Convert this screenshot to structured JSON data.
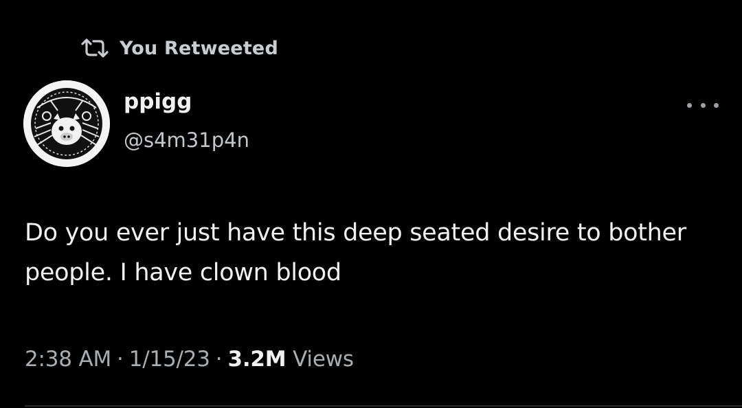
{
  "retweet_banner": {
    "icon": "retweet-icon",
    "label": "You Retweeted"
  },
  "author": {
    "avatar_icon": "avatar-image",
    "display_name": "ppigg",
    "handle": "@s4m31p4n"
  },
  "more_menu": {
    "icon": "more-dots-icon"
  },
  "tweet": {
    "text": "Do you ever just have this deep seated desire to bother people. I have clown blood"
  },
  "meta": {
    "time": "2:38 AM",
    "separator": "·",
    "date": "1/15/23",
    "views_count": "3.2M",
    "views_label": "Views"
  },
  "colors": {
    "background": "#000000",
    "primary_text": "#f0f1f2",
    "secondary_text": "#a9aeb3"
  }
}
